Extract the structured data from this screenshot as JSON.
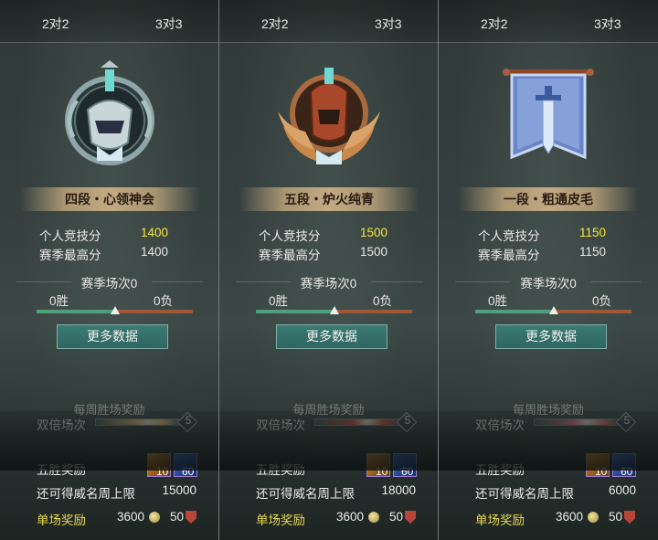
{
  "panels": [
    {
      "tabs": [
        "2对2",
        "3对3"
      ],
      "rank_name": "四段・心领神会",
      "personal_score_label": "个人竞技分",
      "personal_score": "1400",
      "season_high_label": "赛季最高分",
      "season_high": "1400",
      "season_matches": "赛季场次0",
      "wins": "0胜",
      "losses": "0负",
      "win_ratio": 0.5,
      "more_data": "更多数据",
      "weekly_title": "每周胜场奖励",
      "double_label": "双倍场次",
      "double_max": "5",
      "five_win_label": "五胜奖励",
      "reward_1": "10",
      "reward_2": "60",
      "cap_label": "还可得威名周上限",
      "cap_value": "15000",
      "single_label": "单场奖励",
      "single_coins": "3600",
      "single_badge": "50",
      "emblem": "silver-helmet-emblem-icon",
      "double_fill_color": "#d8b070"
    },
    {
      "tabs": [
        "2对2",
        "3对3"
      ],
      "rank_name": "五段・炉火纯青",
      "personal_score_label": "个人竞技分",
      "personal_score": "1500",
      "season_high_label": "赛季最高分",
      "season_high": "1500",
      "season_matches": "赛季场次0",
      "wins": "0胜",
      "losses": "0负",
      "win_ratio": 0.5,
      "more_data": "更多数据",
      "weekly_title": "每周胜场奖励",
      "double_label": "双倍场次",
      "double_max": "5",
      "five_win_label": "五胜奖励",
      "reward_1": "10",
      "reward_2": "60",
      "cap_label": "还可得威名周上限",
      "cap_value": "18000",
      "single_label": "单场奖励",
      "single_coins": "3600",
      "single_badge": "50",
      "emblem": "bronze-winged-helmet-emblem-icon",
      "double_fill_color": "#c8443a"
    },
    {
      "tabs": [
        "2对2",
        "3对3"
      ],
      "rank_name": "一段・粗通皮毛",
      "personal_score_label": "个人竞技分",
      "personal_score": "1150",
      "season_high_label": "赛季最高分",
      "season_high": "1150",
      "season_matches": "赛季场次0",
      "wins": "0胜",
      "losses": "0负",
      "win_ratio": 0.5,
      "more_data": "更多数据",
      "weekly_title": "每周胜场奖励",
      "double_label": "双倍场次",
      "double_max": "5",
      "five_win_label": "五胜奖励",
      "reward_1": "10",
      "reward_2": "60",
      "cap_label": "还可得威名周上限",
      "cap_value": "6000",
      "single_label": "单场奖励",
      "single_coins": "3600",
      "single_badge": "50",
      "emblem": "blue-banner-sword-emblem-icon",
      "double_fill_color": "#d87070"
    }
  ]
}
